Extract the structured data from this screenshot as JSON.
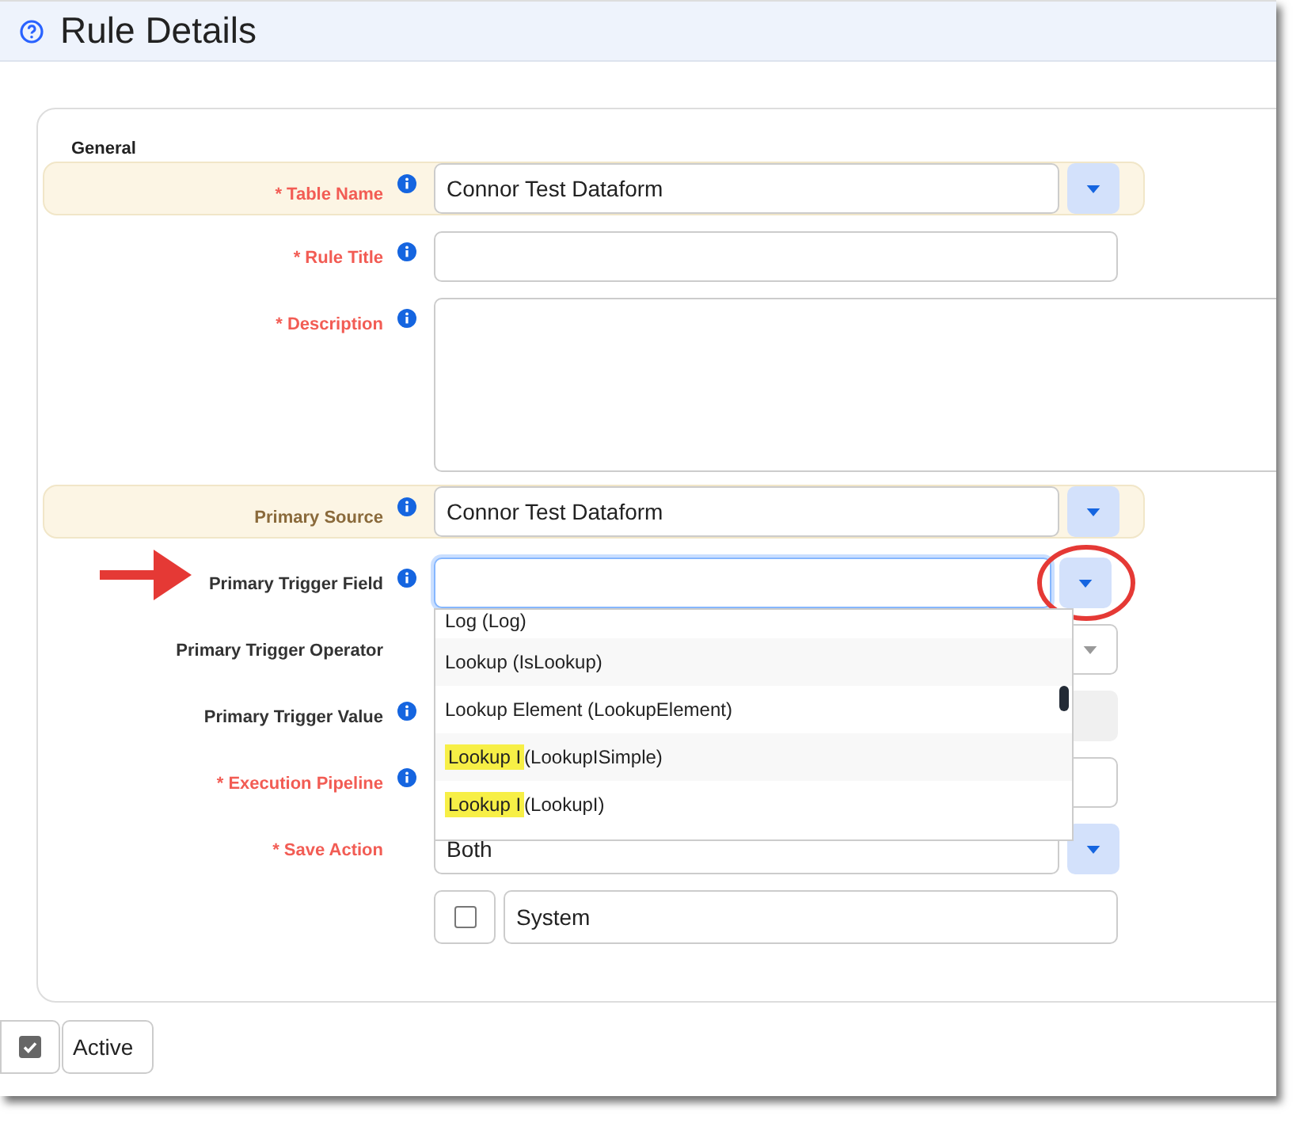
{
  "header": {
    "title": "Rule Details"
  },
  "section": {
    "title": "General"
  },
  "fields": [
    {
      "kind": "select",
      "label": "* Table Name",
      "required": true,
      "info": true,
      "highlighted": true,
      "value": "Connor Test Dataform"
    },
    {
      "kind": "text",
      "label": "* Rule Title",
      "required": true,
      "info": true,
      "highlighted": false
    },
    {
      "kind": "textarea",
      "label": "* Description",
      "required": true,
      "info": true,
      "highlighted": false
    },
    {
      "kind": "select",
      "label": "Primary Source",
      "required": false,
      "info": true,
      "highlighted": true,
      "value": "Connor Test Dataform"
    },
    {
      "kind": "combo",
      "label": "Primary Trigger Field",
      "required": false,
      "info": true,
      "highlighted": false,
      "focused": true,
      "options": [
        {
          "text": "Log (Log)"
        },
        {
          "text": "Lookup (IsLookup)"
        },
        {
          "text": "Lookup Element (LookupElement)"
        },
        {
          "match": "Lookup I",
          "text": " (LookupISimple)"
        },
        {
          "match": "Lookup I",
          "text": " (LookupI)"
        }
      ]
    },
    {
      "kind": "readonly",
      "label": "Primary Trigger Operator",
      "required": false,
      "info": false,
      "highlighted": false
    },
    {
      "kind": "disabled",
      "label": "Primary Trigger Value",
      "required": false,
      "info": true,
      "highlighted": false
    },
    {
      "kind": "text",
      "label": "* Execution Pipeline",
      "required": true,
      "info": true,
      "highlighted": false
    },
    {
      "kind": "select",
      "label": "* Save Action",
      "required": true,
      "info": false,
      "highlighted": false,
      "value": "Both"
    },
    {
      "kind": "checkbox",
      "label": "System",
      "checked": false
    }
  ],
  "active": {
    "label": "Active",
    "checked": true
  }
}
